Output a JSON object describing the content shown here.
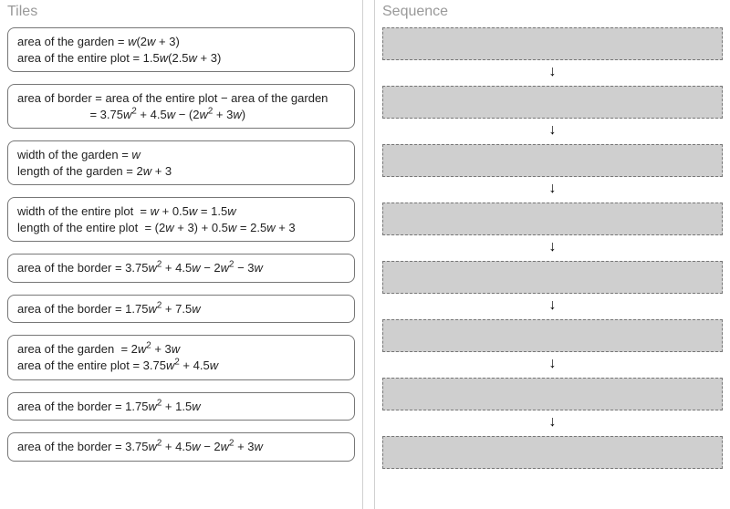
{
  "titles": {
    "tiles": "Tiles",
    "sequence": "Sequence"
  },
  "tiles": [
    {
      "lines": [
        "area of the garden = <span class='it'>w</span>(2<span class='it'>w</span> + 3)",
        "area of the entire plot = 1.5<span class='it'>w</span>(2.5<span class='it'>w</span> + 3)"
      ]
    },
    {
      "lines": [
        "area of border = area of the entire plot − area of the garden",
        "&nbsp;&nbsp;&nbsp;&nbsp;&nbsp;&nbsp;&nbsp;&nbsp;&nbsp;&nbsp;&nbsp;&nbsp;&nbsp;&nbsp;&nbsp;&nbsp;&nbsp;&nbsp;&nbsp;&nbsp;&nbsp;&nbsp;= 3.75<span class='it'>w</span><span class='sup'>2</span> + 4.5<span class='it'>w</span> − (2<span class='it'>w</span><span class='sup'>2</span> + 3<span class='it'>w</span>)"
      ]
    },
    {
      "lines": [
        "width of the garden = <span class='it'>w</span>",
        "length of the garden = 2<span class='it'>w</span> + 3"
      ]
    },
    {
      "lines": [
        "width of the entire plot&nbsp;&nbsp;= <span class='it'>w</span> + 0.5<span class='it'>w</span> = 1.5<span class='it'>w</span>",
        "length of the entire plot&nbsp;&nbsp;= (2<span class='it'>w</span> + 3) + 0.5<span class='it'>w</span> = 2.5<span class='it'>w</span> + 3"
      ]
    },
    {
      "lines": [
        "area of the border = 3.75<span class='it'>w</span><span class='sup'>2</span> + 4.5<span class='it'>w</span> − 2<span class='it'>w</span><span class='sup'>2</span> − 3<span class='it'>w</span>"
      ]
    },
    {
      "lines": [
        "area of the border = 1.75<span class='it'>w</span><span class='sup'>2</span> + 7.5<span class='it'>w</span>"
      ]
    },
    {
      "lines": [
        "area of the garden&nbsp;&nbsp;= 2<span class='it'>w</span><span class='sup'>2</span> + 3<span class='it'>w</span>",
        "area of the entire plot = 3.75<span class='it'>w</span><span class='sup'>2</span> + 4.5<span class='it'>w</span>"
      ]
    },
    {
      "lines": [
        "area of the border = 1.75<span class='it'>w</span><span class='sup'>2</span> + 1.5<span class='it'>w</span>"
      ]
    },
    {
      "lines": [
        "area of the border = 3.75<span class='it'>w</span><span class='sup'>2</span> + 4.5<span class='it'>w</span> − 2<span class='it'>w</span><span class='sup'>2</span> + 3<span class='it'>w</span>"
      ]
    }
  ],
  "arrow_glyph": "↓",
  "slot_count": 8
}
